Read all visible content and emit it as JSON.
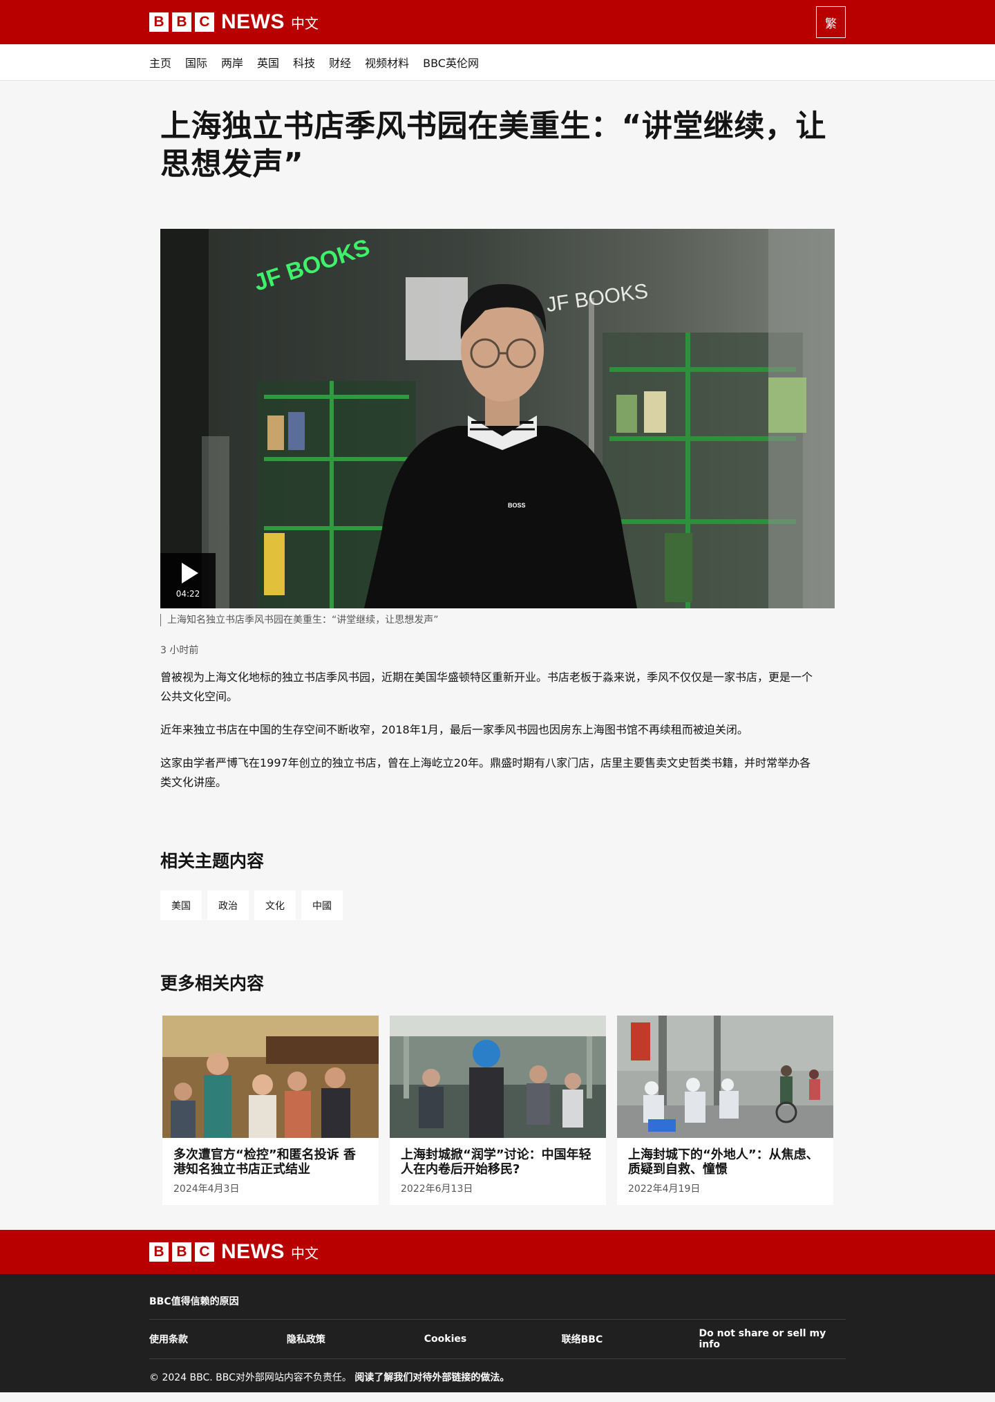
{
  "header": {
    "logo_blocks": [
      "B",
      "B",
      "C"
    ],
    "logo_news": "NEWS",
    "logo_lang": "中文",
    "script_toggle": "繁",
    "brand_color": "#b80000"
  },
  "nav": [
    "主页",
    "国际",
    "两岸",
    "英国",
    "科技",
    "财经",
    "视频材料",
    "BBC英伦网"
  ],
  "article": {
    "headline": "上海独立书店季风书园在美重生：“讲堂继续，让思想发声”",
    "video": {
      "duration": "04:22",
      "caption": "上海知名独立书店季风书园在美重生：“讲堂继续，让思想发声”",
      "image_text": {
        "sign_green": "JF BOOKS",
        "sign_white": "JF BOOKS",
        "shirt_logo": "BOSS"
      }
    },
    "timestamp": "3 小时前",
    "paragraphs": [
      "曾被视为上海文化地标的独立书店季风书园，近期在美国华盛顿特区重新开业。书店老板于淼来说，季风不仅仅是一家书店，更是一个公共文化空间。",
      "近年来独立书店在中国的生存空间不断收窄，2018年1月，最后一家季风书园也因房东上海图书馆不再续租而被迫关闭。",
      "这家由学者严博飞在1997年创立的独立书店，曾在上海屹立20年。鼎盛时期有八家门店，店里主要售卖文史哲类书籍，并时常举办各类文化讲座。"
    ]
  },
  "topics": {
    "title": "相关主题内容",
    "tags": [
      "美国",
      "政治",
      "文化",
      "中國"
    ]
  },
  "related": {
    "title": "更多相关内容",
    "cards": [
      {
        "title": "多次遭官方“检控”和匿名投诉 香港知名独立书店正式结业",
        "date": "2024年4月3日"
      },
      {
        "title": "上海封城掀“润学”讨论：中国年轻人在内卷后开始移民?",
        "date": "2022年6月13日"
      },
      {
        "title": "上海封城下的“外地人”：从焦虑、质疑到自救、憧憬",
        "date": "2022年4月19日"
      }
    ]
  },
  "footer": {
    "trust": "BBC值得信赖的原因",
    "links": [
      "使用条款",
      "隐私政策",
      "Cookies",
      "联络BBC",
      "Do not share or sell my info"
    ],
    "copyright": "© 2024 BBC. BBC对外部网站内容不负责任。",
    "external_policy": "阅读了解我们对待外部链接的做法。"
  }
}
